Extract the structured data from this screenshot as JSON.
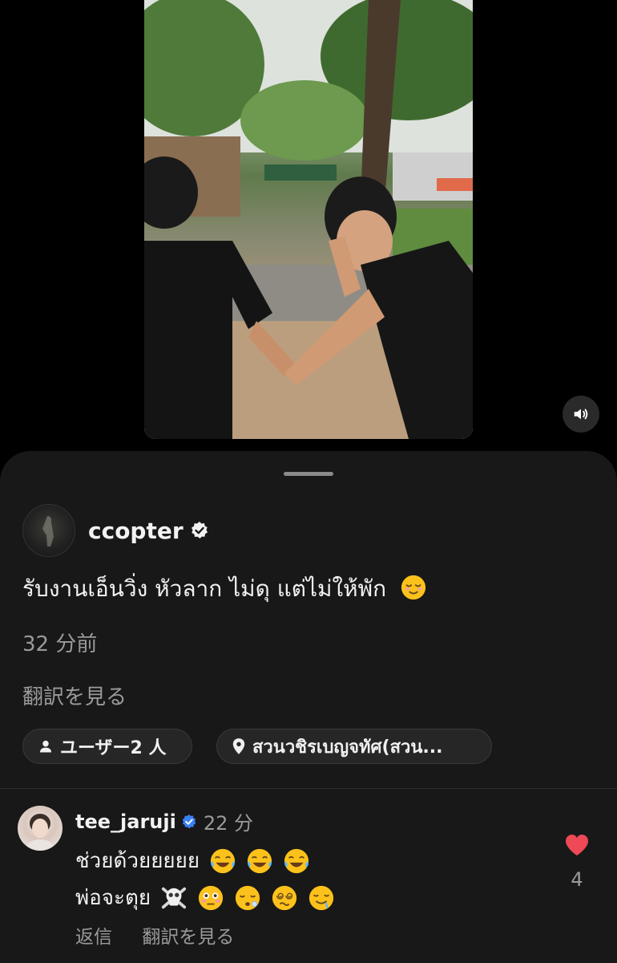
{
  "post": {
    "username": "ccopter",
    "caption": "รับงานเอ็นวิ่ง หัวลาก ไม่ดุ แต่ไม่ให้พัก",
    "caption_emoji": "relieved-face-emoji",
    "time": "32 分前",
    "translate_label": "翻訳を見る",
    "tagged_users_label": "ユーザー2 人",
    "location_label": "สวนวชิรเบญจทัศ(สวน..."
  },
  "comment": {
    "username": "tee_jaruji",
    "time": "22 分",
    "line1": "ช่วยด้วยยยยย",
    "line1_emojis": [
      "tears-of-joy-emoji",
      "tears-of-joy-emoji",
      "tears-of-joy-emoji"
    ],
    "line2": "พ่อจะตุย",
    "line2_emojis": [
      "skull-crossbones-emoji",
      "flushed-face-emoji",
      "sleepy-face-emoji",
      "dizzy-face-emoji",
      "drooling-face-emoji"
    ],
    "reply_label": "返信",
    "translate_label": "翻訳を見る",
    "like_count": "4"
  },
  "colors": {
    "background": "#000000",
    "sheet": "#181818",
    "secondary_text": "#9a9a9a",
    "verified_blue": "#3b82f6",
    "like_red": "#ed4956"
  }
}
